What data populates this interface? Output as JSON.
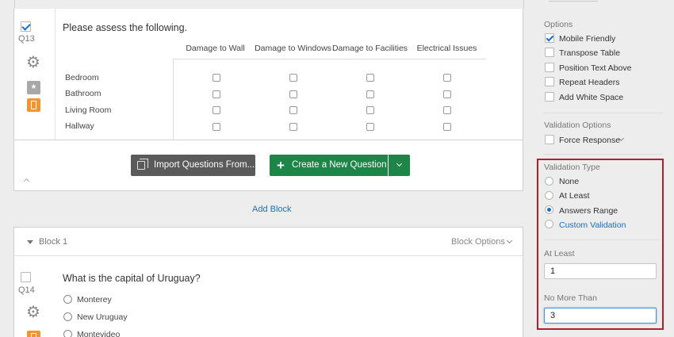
{
  "q13": {
    "number": "Q13",
    "text": "Please assess the following.",
    "columns": [
      "Damage to Wall",
      "Damage to Windows",
      "Damage to Facilities",
      "Electrical Issues"
    ],
    "rows": [
      "Bedroom",
      "Bathroom",
      "Living Room",
      "Hallway"
    ]
  },
  "toolbar": {
    "import_label": "Import Questions From...",
    "create_label": "Create a New Question"
  },
  "add_block_label": "Add Block",
  "block1": {
    "title": "Block 1",
    "options_label": "Block Options"
  },
  "q14": {
    "number": "Q14",
    "text": "What is the capital of Uruguay?",
    "choices": [
      "Monterey",
      "New Uruguay",
      "Montevideo"
    ]
  },
  "panel": {
    "options_title": "Options",
    "options": [
      {
        "label": "Mobile Friendly",
        "checked": true
      },
      {
        "label": "Transpose Table",
        "checked": false
      },
      {
        "label": "Position Text Above",
        "checked": false
      },
      {
        "label": "Repeat Headers",
        "checked": false
      },
      {
        "label": "Add White Space",
        "checked": false
      }
    ],
    "validation_options_title": "Validation Options",
    "force_response_label": "Force Response",
    "validation_type_title": "Validation Type",
    "validation_types": [
      {
        "label": "None",
        "selected": false
      },
      {
        "label": "At Least",
        "selected": false
      },
      {
        "label": "Answers Range",
        "selected": true
      },
      {
        "label": "Custom Validation",
        "selected": false
      }
    ],
    "at_least_label": "At Least",
    "at_least_value": "1",
    "no_more_than_label": "No More Than",
    "no_more_than_value": "3"
  },
  "colors": {
    "accent_blue": "#1b6fc4",
    "create_green": "#1d8547",
    "highlight_red": "#b21f2d",
    "mobile_orange": "#f29530"
  },
  "icons": [
    "checkmark-icon",
    "gear-icon",
    "asterisk-icon",
    "mobile-icon",
    "plus-icon",
    "chevron-down-icon",
    "triangle-down-icon"
  ]
}
